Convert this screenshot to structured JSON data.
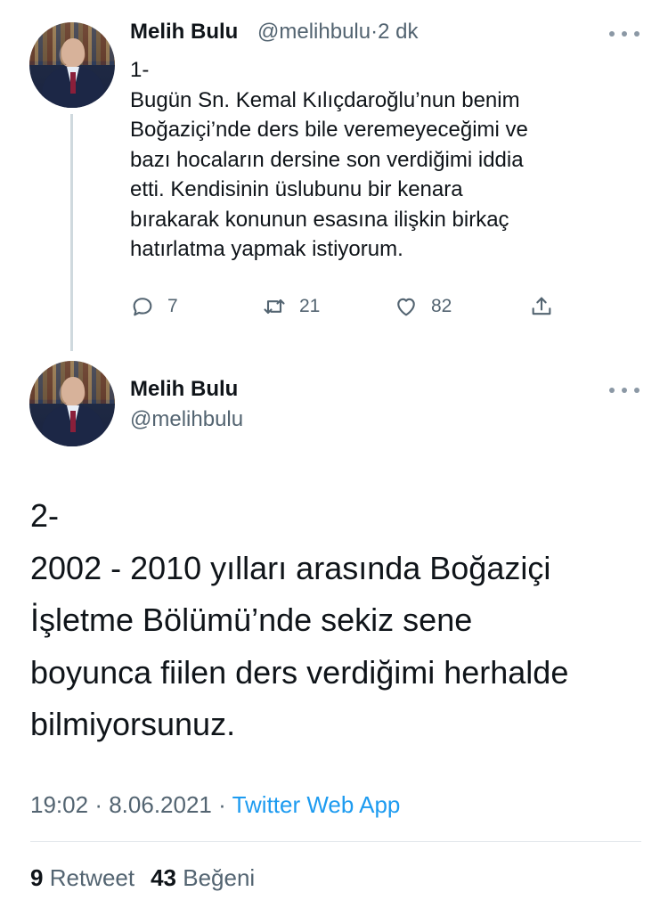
{
  "tweet1": {
    "name": "Melih Bulu",
    "handle": "@melihbulu",
    "separator": "·",
    "time": "2 dk",
    "lines": [
      "1-",
      "Bugün Sn. Kemal Kılıçdaroğlu’nun benim",
      "Boğaziçi’nde ders bile veremeyeceğimi ve",
      "bazı hocaların dersine son verdiğimi iddia",
      "etti. Kendisinin üslubunu bir kenara",
      "bırakarak konunun esasına ilişkin birkaç",
      "hatırlatma yapmak istiyorum."
    ],
    "actions": {
      "reply_icon": "reply-icon",
      "reply_count": "7",
      "retweet_icon": "retweet-icon",
      "retweet_count": "21",
      "like_icon": "heart-icon",
      "like_count": "82",
      "share_icon": "share-icon"
    }
  },
  "tweet2": {
    "name": "Melih Bulu",
    "handle": "@melihbulu",
    "lines": [
      "2-",
      "2002 - 2010 yılları arasında Boğaziçi",
      "İşletme Bölümü’nde sekiz sene",
      "boyunca fiilen ders verdiğimi herhalde",
      "bilmiyorsunuz."
    ],
    "time": "19:02",
    "date": "8.06.2021",
    "separator": "·",
    "source": "Twitter Web App",
    "retweet_count": "9",
    "retweet_label": "Retweet",
    "like_count": "43",
    "like_label": "Beğeni"
  },
  "colors": {
    "text": "#0f1419",
    "secondary": "#536471",
    "link": "#1d9bf0",
    "thread_line": "#cfd9de"
  }
}
